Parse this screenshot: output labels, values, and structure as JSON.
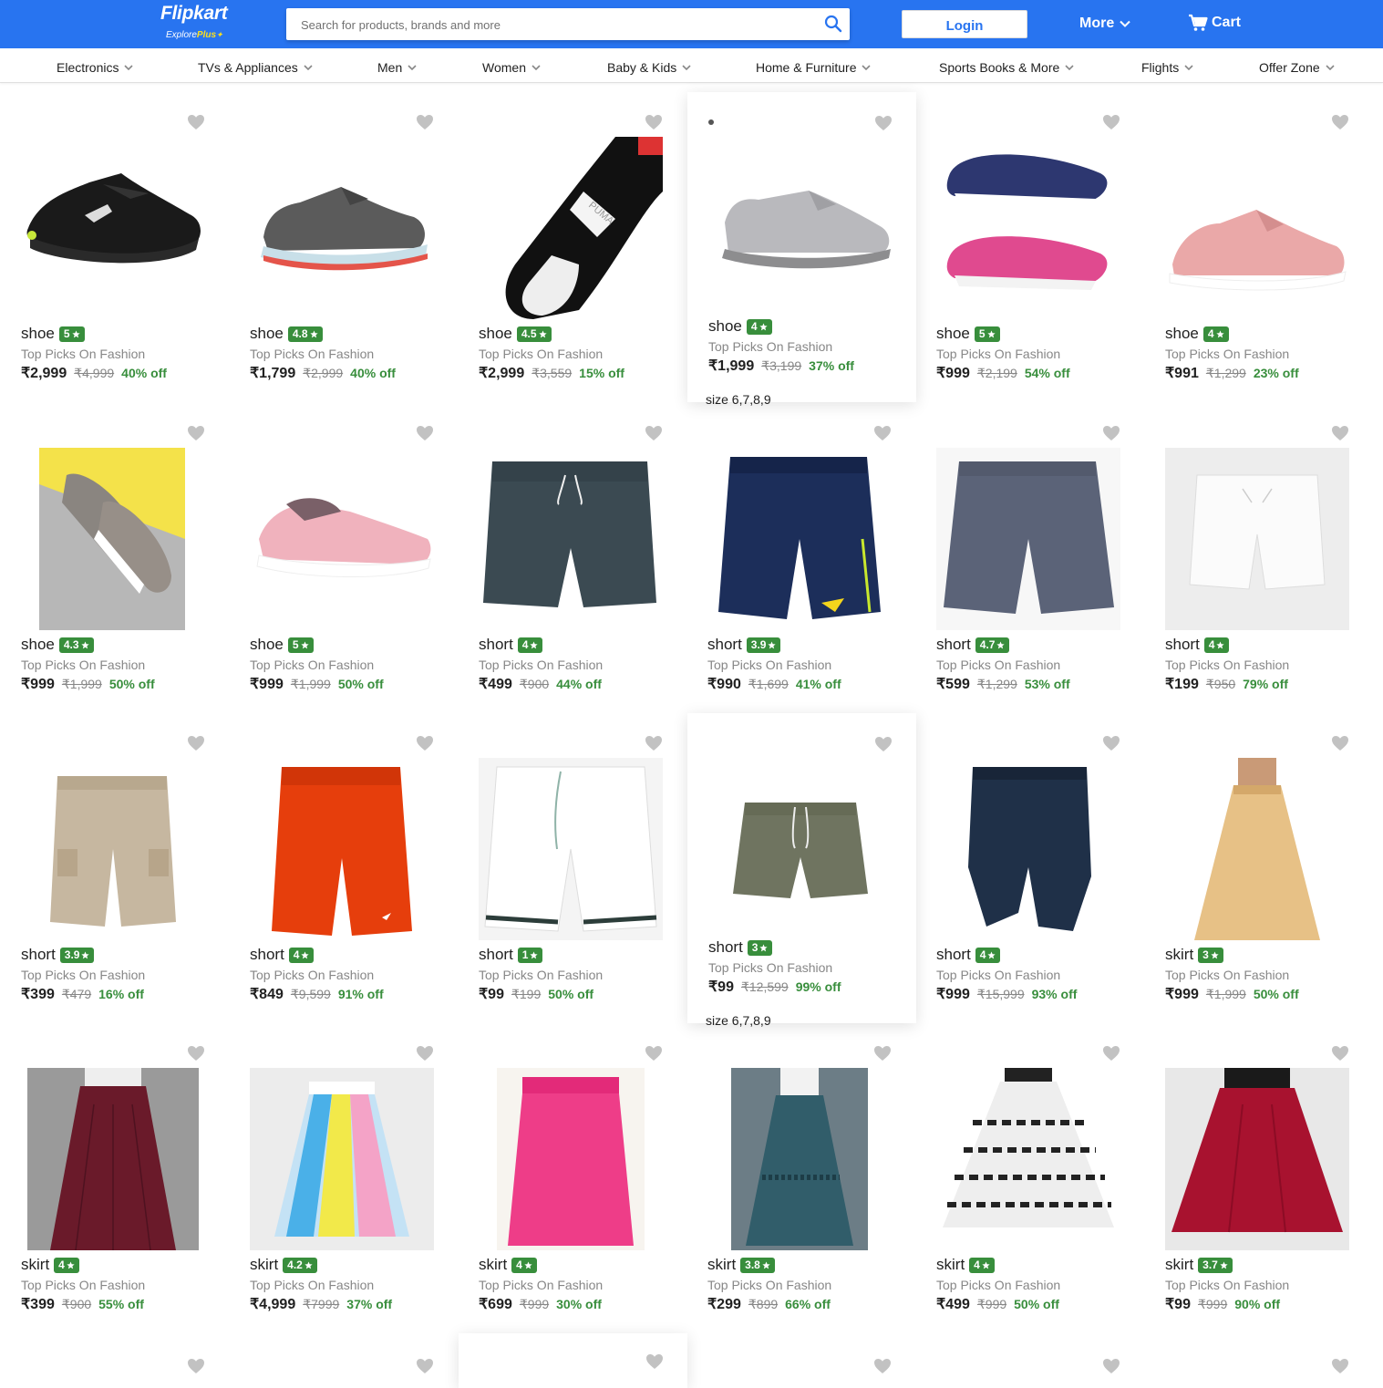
{
  "header": {
    "logo": "Flipkart",
    "logo_sub_prefix": "Explore",
    "logo_sub_plus": "Plus",
    "search_placeholder": "Search for products, brands and more",
    "login_label": "Login",
    "more_label": "More",
    "cart_label": "Cart",
    "color_primary": "#2874f0"
  },
  "categories": [
    "Electronics",
    "TVs & Appliances",
    "Men",
    "Women",
    "Baby & Kids",
    "Home & Furniture",
    "Sports Books & More",
    "Flights",
    "Offer Zone"
  ],
  "product_subtitle": "Top Picks On Fashion",
  "size_label": "size 6,7,8,9",
  "products": [
    {
      "name": "shoe",
      "rating": "5",
      "price": "₹2,999",
      "mrp": "₹4,999",
      "off": "40% off",
      "img": "shoe-black"
    },
    {
      "name": "shoe",
      "rating": "4.8",
      "price": "₹1,799",
      "mrp": "₹2,999",
      "off": "40% off",
      "img": "shoe-grey"
    },
    {
      "name": "shoe",
      "rating": "4.5",
      "price": "₹2,999",
      "mrp": "₹3,559",
      "off": "15% off",
      "img": "shoe-puma"
    },
    {
      "name": "shoe",
      "rating": "4",
      "price": "₹1,999",
      "mrp": "₹3,199",
      "off": "37% off",
      "img": "shoe-lightgrey",
      "hover": true
    },
    {
      "name": "shoe",
      "rating": "5",
      "price": "₹999",
      "mrp": "₹2,199",
      "off": "54% off",
      "img": "shoe-bellies"
    },
    {
      "name": "shoe",
      "rating": "4",
      "price": "₹991",
      "mrp": "₹1,299",
      "off": "23% off",
      "img": "shoe-pink"
    },
    {
      "name": "shoe",
      "rating": "4.3",
      "price": "₹999",
      "mrp": "₹1,999",
      "off": "50% off",
      "img": "shoe-taupe"
    },
    {
      "name": "shoe",
      "rating": "5",
      "price": "₹999",
      "mrp": "₹1,999",
      "off": "50% off",
      "img": "shoe-pinkknit"
    },
    {
      "name": "short",
      "rating": "4",
      "price": "₹499",
      "mrp": "₹900",
      "off": "44% off",
      "img": "short-charcoal"
    },
    {
      "name": "short",
      "rating": "3.9",
      "price": "₹990",
      "mrp": "₹1,699",
      "off": "41% off",
      "img": "short-navy"
    },
    {
      "name": "short",
      "rating": "4.7",
      "price": "₹599",
      "mrp": "₹1,299",
      "off": "53% off",
      "img": "short-slate"
    },
    {
      "name": "short",
      "rating": "4",
      "price": "₹199",
      "mrp": "₹950",
      "off": "79% off",
      "img": "short-white"
    },
    {
      "name": "short",
      "rating": "3.9",
      "price": "₹399",
      "mrp": "₹479",
      "off": "16% off",
      "img": "short-khaki"
    },
    {
      "name": "short",
      "rating": "4",
      "price": "₹849",
      "mrp": "₹9,599",
      "off": "91% off",
      "img": "short-orange"
    },
    {
      "name": "short",
      "rating": "1",
      "price": "₹99",
      "mrp": "₹199",
      "off": "50% off",
      "img": "short-whitestripe"
    },
    {
      "name": "short",
      "rating": "3",
      "price": "₹99",
      "mrp": "₹12,599",
      "off": "99% off",
      "img": "short-olive",
      "hover": true
    },
    {
      "name": "short",
      "rating": "4",
      "price": "₹999",
      "mrp": "₹15,999",
      "off": "93% off",
      "img": "short-cycling"
    },
    {
      "name": "skirt",
      "rating": "3",
      "price": "₹999",
      "mrp": "₹1,999",
      "off": "50% off",
      "img": "skirt-gold"
    },
    {
      "name": "skirt",
      "rating": "4",
      "price": "₹399",
      "mrp": "₹900",
      "off": "55% off",
      "img": "skirt-maroon"
    },
    {
      "name": "skirt",
      "rating": "4.2",
      "price": "₹4,999",
      "mrp": "₹7999",
      "off": "37% off",
      "img": "skirt-rainbow"
    },
    {
      "name": "skirt",
      "rating": "4",
      "price": "₹699",
      "mrp": "₹999",
      "off": "30% off",
      "img": "skirt-pink"
    },
    {
      "name": "skirt",
      "rating": "3.8",
      "price": "₹299",
      "mrp": "₹899",
      "off": "66% off",
      "img": "skirt-teal"
    },
    {
      "name": "skirt",
      "rating": "4",
      "price": "₹499",
      "mrp": "₹999",
      "off": "50% off",
      "img": "skirt-print"
    },
    {
      "name": "skirt",
      "rating": "3.7",
      "price": "₹99",
      "mrp": "₹999",
      "off": "90% off",
      "img": "skirt-red"
    }
  ]
}
